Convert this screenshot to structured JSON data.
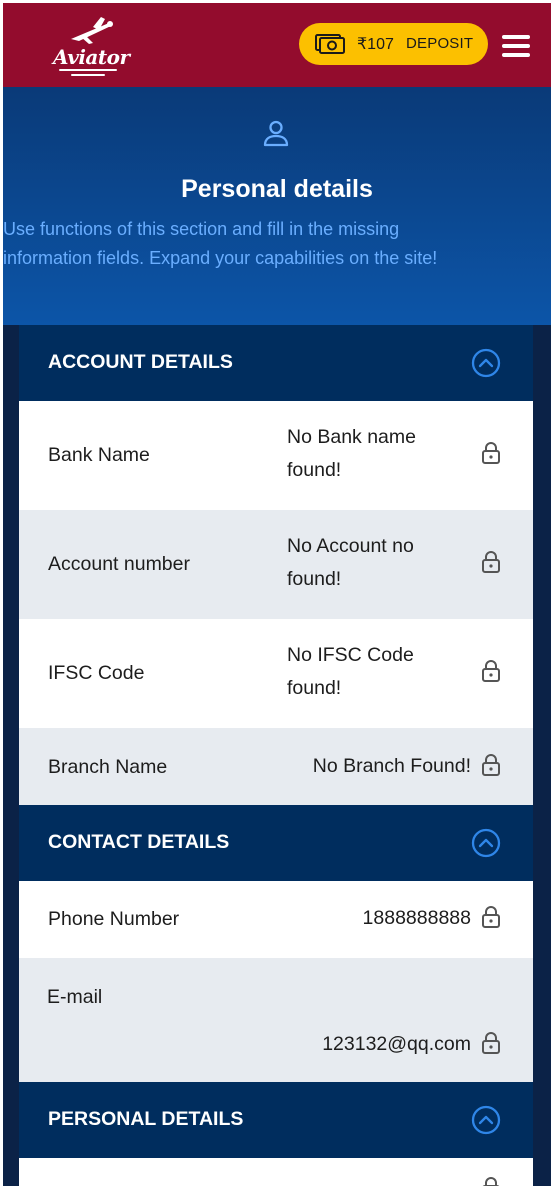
{
  "header": {
    "logo_text": "Aviator",
    "balance": "₹107",
    "deposit_label": "DEPOSIT"
  },
  "hero": {
    "title": "Personal details",
    "description_line1": "Use functions of this section and fill in the missing",
    "description_line2": "information fields. Expand your capabilities on the site!"
  },
  "sections": {
    "account": {
      "title": "ACCOUNT DETAILS",
      "rows": [
        {
          "label": "Bank Name",
          "value_line1": "No Bank name",
          "value_line2": "found!"
        },
        {
          "label": "Account number",
          "value_line1": "No Account no",
          "value_line2": "found!"
        },
        {
          "label": "IFSC Code",
          "value_line1": "No IFSC Code",
          "value_line2": "found!"
        },
        {
          "label": "Branch Name",
          "value": "No Branch Found!"
        }
      ]
    },
    "contact": {
      "title": "CONTACT DETAILS",
      "rows": [
        {
          "label": "Phone Number",
          "value": "1888888888"
        },
        {
          "label": "E-mail",
          "value": "123132@qq.com"
        }
      ]
    },
    "personal": {
      "title": "PERSONAL DETAILS"
    }
  },
  "colors": {
    "header_bg": "#930c2d",
    "deposit_bg": "#fcc000",
    "section_header_bg": "#002d5e",
    "accent_blue": "#2f86e8",
    "hero_text": "#6aaeff"
  },
  "icons": [
    "aviator-logo",
    "cash-icon",
    "hamburger-icon",
    "user-icon",
    "chevron-up-icon",
    "lock-icon"
  ]
}
